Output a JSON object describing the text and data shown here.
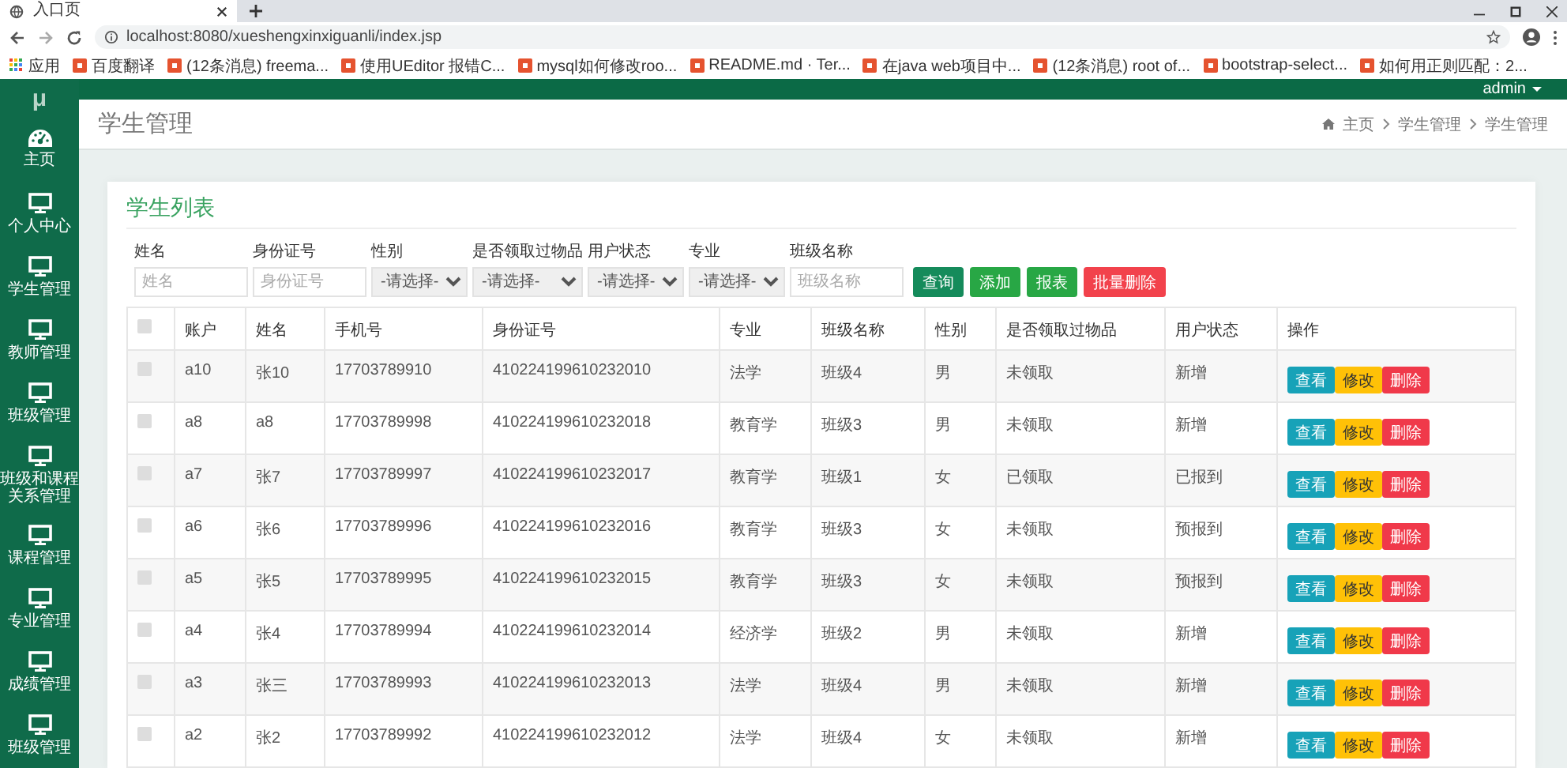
{
  "browser": {
    "tab_title": "入口页",
    "url": "localhost:8080/xueshengxinxiguanli/index.jsp",
    "bookmarks": [
      {
        "label": "应用",
        "kind": "apps"
      },
      {
        "label": "百度翻译",
        "kind": "page"
      },
      {
        "label": "(12条消息) freema...",
        "kind": "page"
      },
      {
        "label": "使用UEditor 报错C...",
        "kind": "page"
      },
      {
        "label": "mysql如何修改roo...",
        "kind": "page"
      },
      {
        "label": "README.md · Ter...",
        "kind": "page"
      },
      {
        "label": "在java web项目中...",
        "kind": "page"
      },
      {
        "label": "(12条消息) root of...",
        "kind": "page"
      },
      {
        "label": "bootstrap-select...",
        "kind": "page"
      },
      {
        "label": "如何用正则匹配：2...",
        "kind": "page"
      }
    ]
  },
  "app": {
    "logo": "μ",
    "user": "admin"
  },
  "sidebar": {
    "items": [
      {
        "label": "主页",
        "kind": "dashboard"
      },
      {
        "label": "个人中心",
        "kind": "module"
      },
      {
        "label": "学生管理",
        "kind": "module"
      },
      {
        "label": "教师管理",
        "kind": "module"
      },
      {
        "label": "班级管理",
        "kind": "module"
      },
      {
        "label": "班级和课程关系管理",
        "kind": "module"
      },
      {
        "label": "课程管理",
        "kind": "module"
      },
      {
        "label": "专业管理",
        "kind": "module"
      },
      {
        "label": "成绩管理",
        "kind": "module"
      },
      {
        "label": "班级管理",
        "kind": "module"
      }
    ]
  },
  "page": {
    "title": "学生管理",
    "breadcrumb": [
      "主页",
      "学生管理",
      "学生管理"
    ]
  },
  "card": {
    "title": "学生列表"
  },
  "filters": [
    {
      "label": "姓名",
      "kind": "input",
      "placeholder": "姓名"
    },
    {
      "label": "身份证号",
      "kind": "input",
      "placeholder": "身份证号"
    },
    {
      "label": "性别",
      "kind": "select",
      "value": "-请选择-"
    },
    {
      "label": "是否领取过物品",
      "kind": "select",
      "value": "-请选择-"
    },
    {
      "label": "用户状态",
      "kind": "select",
      "value": "-请选择-"
    },
    {
      "label": "专业",
      "kind": "select",
      "value": "-请选择-"
    },
    {
      "label": "班级名称",
      "kind": "input",
      "placeholder": "班级名称"
    }
  ],
  "buttons": [
    {
      "label": "查询",
      "kind": "search"
    },
    {
      "label": "添加",
      "kind": "add"
    },
    {
      "label": "报表",
      "kind": "report"
    },
    {
      "label": "批量删除",
      "kind": "delete"
    }
  ],
  "table": {
    "select_all": {
      "checked": false
    },
    "columns": [
      "账户",
      "姓名",
      "手机号",
      "身份证号",
      "专业",
      "班级名称",
      "性别",
      "是否领取过物品",
      "用户状态",
      "操作"
    ],
    "rows": [
      {
        "checked": false,
        "cells": [
          "a10",
          "张10",
          "17703789910",
          "410224199610232010",
          "法学",
          "班级4",
          "男",
          "未领取",
          "新增"
        ],
        "actions": [
          {
            "label": "查看",
            "kind": "view"
          },
          {
            "label": "修改",
            "kind": "edit"
          },
          {
            "label": "删除",
            "kind": "delete"
          }
        ]
      },
      {
        "checked": false,
        "cells": [
          "a8",
          "a8",
          "17703789998",
          "410224199610232018",
          "教育学",
          "班级3",
          "男",
          "未领取",
          "新增"
        ],
        "actions": [
          {
            "label": "查看",
            "kind": "view"
          },
          {
            "label": "修改",
            "kind": "edit"
          },
          {
            "label": "删除",
            "kind": "delete"
          }
        ]
      },
      {
        "checked": false,
        "cells": [
          "a7",
          "张7",
          "17703789997",
          "410224199610232017",
          "教育学",
          "班级1",
          "女",
          "已领取",
          "已报到"
        ],
        "actions": [
          {
            "label": "查看",
            "kind": "view"
          },
          {
            "label": "修改",
            "kind": "edit"
          },
          {
            "label": "删除",
            "kind": "delete"
          }
        ]
      },
      {
        "checked": false,
        "cells": [
          "a6",
          "张6",
          "17703789996",
          "410224199610232016",
          "教育学",
          "班级3",
          "女",
          "未领取",
          "预报到"
        ],
        "actions": [
          {
            "label": "查看",
            "kind": "view"
          },
          {
            "label": "修改",
            "kind": "edit"
          },
          {
            "label": "删除",
            "kind": "delete"
          }
        ]
      },
      {
        "checked": false,
        "cells": [
          "a5",
          "张5",
          "17703789995",
          "410224199610232015",
          "教育学",
          "班级3",
          "女",
          "未领取",
          "预报到"
        ],
        "actions": [
          {
            "label": "查看",
            "kind": "view"
          },
          {
            "label": "修改",
            "kind": "edit"
          },
          {
            "label": "删除",
            "kind": "delete"
          }
        ]
      },
      {
        "checked": false,
        "cells": [
          "a4",
          "张4",
          "17703789994",
          "410224199610232014",
          "经济学",
          "班级2",
          "男",
          "未领取",
          "新增"
        ],
        "actions": [
          {
            "label": "查看",
            "kind": "view"
          },
          {
            "label": "修改",
            "kind": "edit"
          },
          {
            "label": "删除",
            "kind": "delete"
          }
        ]
      },
      {
        "checked": false,
        "cells": [
          "a3",
          "张三",
          "17703789993",
          "410224199610232013",
          "法学",
          "班级4",
          "男",
          "未领取",
          "新增"
        ],
        "actions": [
          {
            "label": "查看",
            "kind": "view"
          },
          {
            "label": "修改",
            "kind": "edit"
          },
          {
            "label": "删除",
            "kind": "delete"
          }
        ]
      },
      {
        "checked": false,
        "cells": [
          "a2",
          "张2",
          "17703789992",
          "410224199610232012",
          "法学",
          "班级4",
          "女",
          "未领取",
          "新增"
        ],
        "actions": [
          {
            "label": "查看",
            "kind": "view"
          },
          {
            "label": "修改",
            "kind": "edit"
          },
          {
            "label": "删除",
            "kind": "delete"
          }
        ]
      }
    ]
  }
}
